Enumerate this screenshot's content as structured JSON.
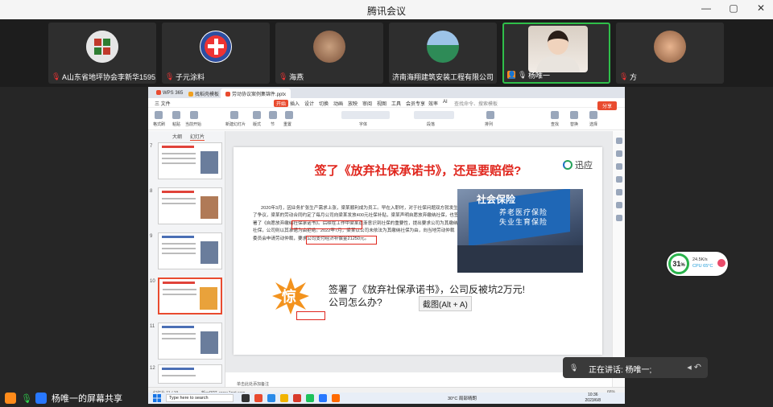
{
  "window": {
    "title": "腾讯会议",
    "controls": [
      "—",
      "▢",
      "✕"
    ]
  },
  "participants": [
    {
      "name": "A山东省地坪协会李新华1595...",
      "muted": true,
      "avatar_color": "#c9c9c9"
    },
    {
      "name": "子元涂料",
      "muted": true,
      "avatar_color": "#2d4fa1"
    },
    {
      "name": "海燕",
      "muted": true,
      "avatar_color": "#b07a57"
    },
    {
      "name": "济南海翔建筑安装工程有限公司",
      "muted": false,
      "avatar_color": "#2e8b57"
    },
    {
      "name": "杨唯一",
      "muted": false,
      "active": true
    },
    {
      "name": "方",
      "muted": true,
      "avatar_color": "#c98a66"
    }
  ],
  "app": {
    "tabs": [
      "WPS 365",
      "找稻壳模板",
      "劳动协议案例集锦件.pptx"
    ],
    "menu": [
      "三 文件",
      "开始",
      "插入",
      "设计",
      "切换",
      "动画",
      "放映",
      "审阅",
      "视图",
      "工具",
      "会员专享",
      "效率",
      "AI",
      "查找命令、搜索模板"
    ],
    "ribbon": [
      "格式刷",
      "粘贴",
      "当前开始",
      "新建幻灯片",
      "版式",
      "节",
      "重置",
      "字体",
      "段落",
      "排列",
      "查找",
      "替换",
      "选择"
    ],
    "save_label": "分享",
    "left_tabs": [
      "大纲",
      "幻灯片"
    ],
    "slide_numbers": [
      "7",
      "8",
      "9",
      "10",
      "11",
      "12"
    ],
    "right_tools": [
      "select",
      "shape",
      "animation",
      "format",
      "zoom",
      "settings",
      "help"
    ]
  },
  "slide": {
    "title": "签了《放弃社保承诺书》，还是要赔偿?",
    "logo": "迅应",
    "body": "2020年3月，因业务扩张生产需求上涨，梁某顺利成为员工。早在入职时，对于社保问题双方就发生了争议，梁某的劳动合同约定了每月公司向梁某发放400元社保补贴，梁某声明自愿放弃缴纳社保，也签署了《自愿放弃缴纳社保承诺书》。后续在工作中梁某逐渐意识到社保的重要性，提出要求公司为其缴纳社保，公司则以其承诺为由拒绝。2022年7月，梁某以公司未依法为其缴纳社保为由，向当地劳动仲裁委员会申请劳动仲裁，要求公司支付经济补偿金21250元。",
    "photo_lines": [
      "社会保险",
      "养老医疗保险",
      "失业生育保险"
    ],
    "burst": "惊",
    "question1": "签署了《放弃社保承诺书》，公司反被坑2万元!",
    "question2": "公司怎么办?",
    "tooltip": "截图(Alt + A)"
  },
  "status": {
    "slide_info": "幻灯片 11 / 19",
    "theme": "新一PPT, www.1ppt.com",
    "notes": "单击此处添加备注",
    "zoom": "66%"
  },
  "taskbar": {
    "search": "Type here to search",
    "weather": "30°C 局部晴朗",
    "time": "10:36",
    "date": "2023/6/8"
  },
  "monitor": {
    "percent": "31",
    "unit": "%",
    "net": "24.5K/s",
    "cpu": "CPU 65°C"
  },
  "speaking": {
    "label": "正在讲话:",
    "name": "杨唯一;"
  },
  "share_bar": {
    "label": "杨唯一的屏幕共享"
  }
}
